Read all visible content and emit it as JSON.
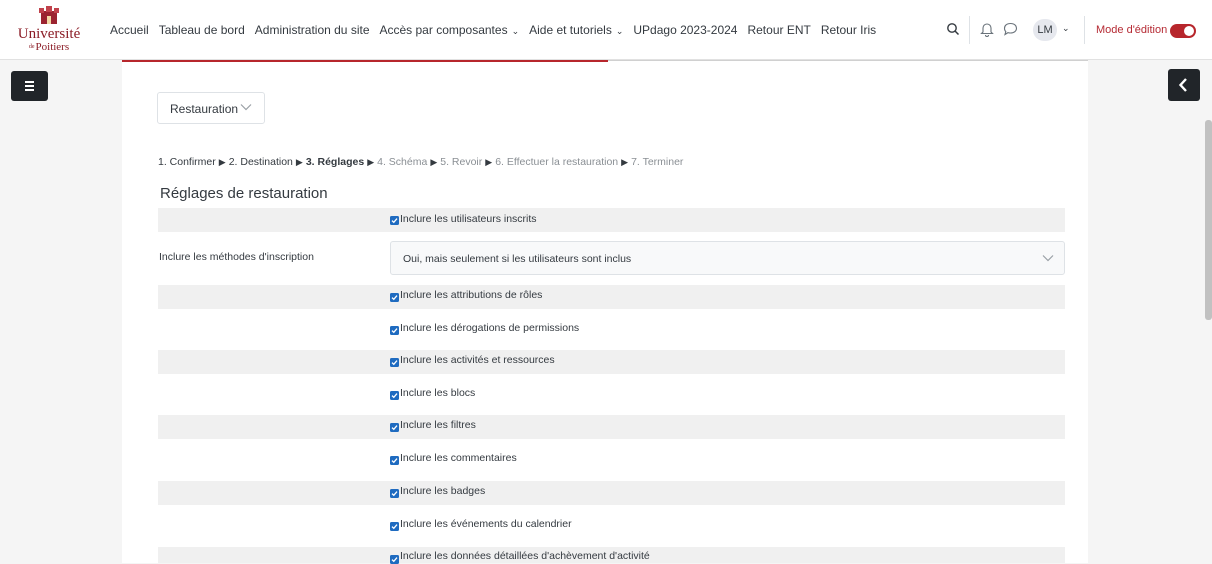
{
  "brand": {
    "line1": "Université",
    "line2_prefix": "de",
    "line2": "Poitiers"
  },
  "nav": [
    {
      "label": "Accueil",
      "dropdown": false
    },
    {
      "label": "Tableau de bord",
      "dropdown": false
    },
    {
      "label": "Administration du site",
      "dropdown": false
    },
    {
      "label": "Accès par composantes",
      "dropdown": true
    },
    {
      "label": "Aide et tutoriels",
      "dropdown": true
    },
    {
      "label": "UPdago 2023-2024",
      "dropdown": false
    },
    {
      "label": "Retour ENT",
      "dropdown": false
    },
    {
      "label": "Retour Iris",
      "dropdown": false
    }
  ],
  "user": {
    "initials": "LM"
  },
  "edit_mode": {
    "label": "Mode d'édition",
    "enabled": true
  },
  "page_select": {
    "value": "Restauration"
  },
  "steps": [
    {
      "label": "1. Confirmer",
      "state": "done"
    },
    {
      "label": "2. Destination",
      "state": "done"
    },
    {
      "label": "3. Réglages",
      "state": "current"
    },
    {
      "label": "4. Schéma",
      "state": "future"
    },
    {
      "label": "5. Revoir",
      "state": "future"
    },
    {
      "label": "6. Effectuer la restauration",
      "state": "future"
    },
    {
      "label": "7. Terminer",
      "state": "future"
    }
  ],
  "section_title": "Réglages de restauration",
  "settings": {
    "users": "Inclure les utilisateurs inscrits",
    "enrol_label": "Inclure les méthodes d'inscription",
    "enrol_value": "Oui, mais seulement si les utilisateurs sont inclus",
    "roles": "Inclure les attributions de rôles",
    "permissions": "Inclure les dérogations de permissions",
    "activities": "Inclure les activités et ressources",
    "blocks": "Inclure les blocs",
    "filters": "Inclure les filtres",
    "comments": "Inclure les commentaires",
    "badges": "Inclure les badges",
    "calendar": "Inclure les événements du calendrier",
    "completion": "Inclure les données détaillées d'achèvement d'activité"
  },
  "colors": {
    "accent": "#b7262c",
    "checkbox": "#1f6bc0",
    "dark_button": "#212529"
  }
}
